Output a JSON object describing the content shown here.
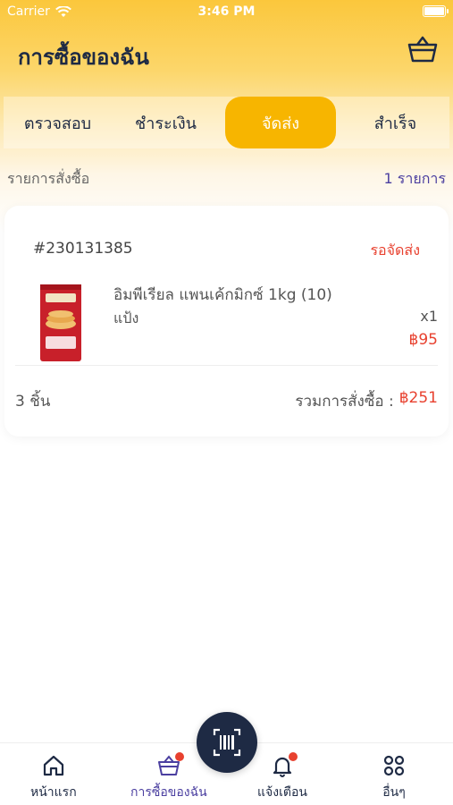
{
  "status_bar": {
    "carrier": "Carrier",
    "time": "3:46 PM",
    "battery_level": 1.0
  },
  "header": {
    "title": "การซื้อของฉัน",
    "cart_icon": "basket-icon"
  },
  "tabs": [
    {
      "label": "ตรวจสอบ",
      "active": false
    },
    {
      "label": "ชำระเงิน",
      "active": false
    },
    {
      "label": "จัดส่ง",
      "active": true
    },
    {
      "label": "สำเร็จ",
      "active": false
    }
  ],
  "list": {
    "label": "รายการสั่งซื้อ",
    "count": "1 รายการ"
  },
  "order": {
    "number": "#230131385",
    "status": "รอจัดส่ง",
    "product": {
      "name": "อิมพีเรียล แพนเค้กมิกซ์ 1kg (10)",
      "category": "แป้ง",
      "quantity": "x1",
      "price": "฿95"
    },
    "items_count": "3 ชิ้น",
    "total_label": "รวมการสั่งซื้อ :",
    "total_amount": "฿251"
  },
  "nav": {
    "home": "หน้าแรก",
    "orders": "การซื้อของฉัน",
    "notifications": "แจ้งเตือน",
    "more": "อื่นๆ"
  },
  "colors": {
    "accent": "#f7b500",
    "navy": "#1e2a44",
    "purple": "#4b3fa0",
    "red": "#e8412f"
  }
}
